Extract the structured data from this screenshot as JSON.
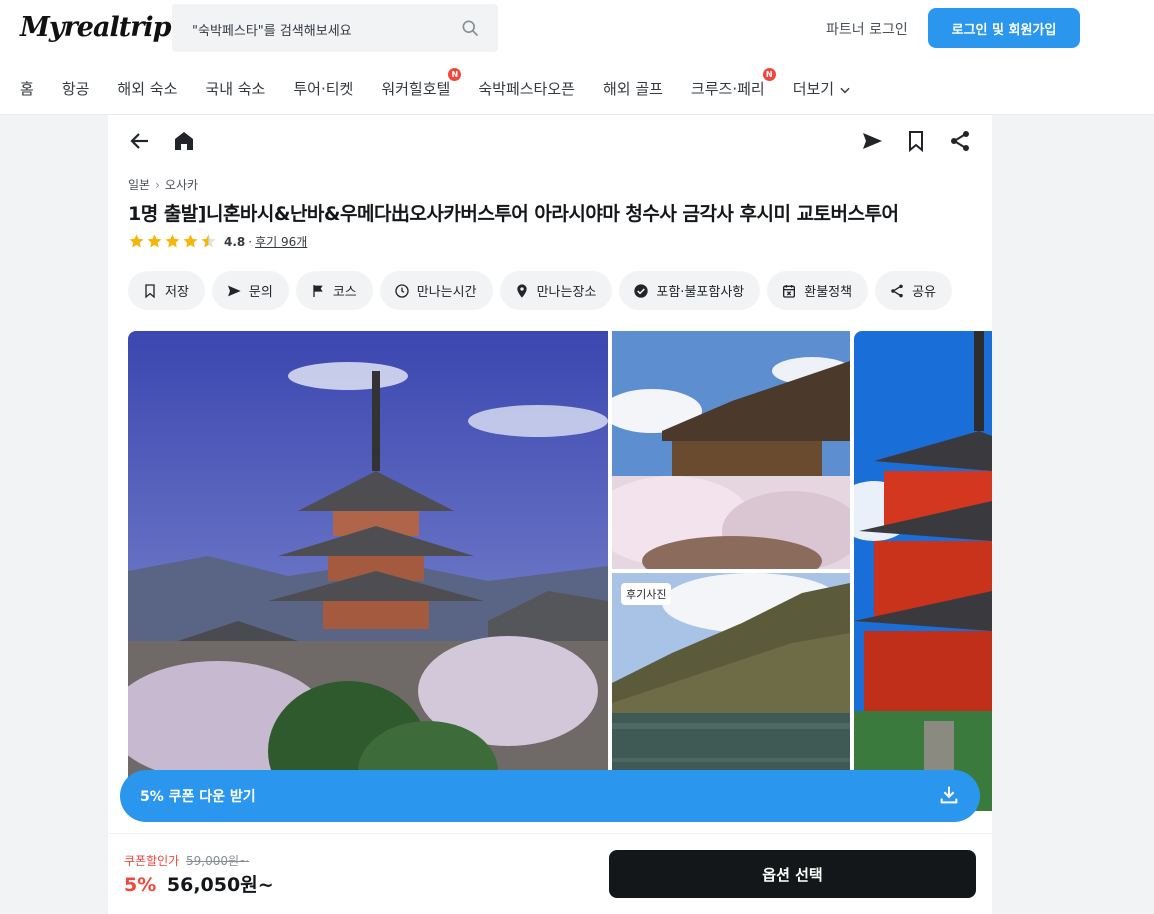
{
  "header": {
    "logo": "Myrealtrip",
    "search_placeholder": "\"숙박페스타\"를 검색해보세요",
    "partner_login": "파트너 로그인",
    "login_signup": "로그인 및 회원가입"
  },
  "nav": {
    "items": [
      {
        "label": "홈"
      },
      {
        "label": "항공"
      },
      {
        "label": "해외 숙소"
      },
      {
        "label": "국내 숙소"
      },
      {
        "label": "투어·티켓"
      },
      {
        "label": "워커힐호텔",
        "badge": "N"
      },
      {
        "label": "숙박페스타오픈"
      },
      {
        "label": "해외 골프"
      },
      {
        "label": "크루즈·페리",
        "badge": "N"
      },
      {
        "label": "더보기"
      }
    ]
  },
  "product": {
    "breadcrumb": [
      "일본",
      "오사카"
    ],
    "title": "1명 출발]니혼바시&난바&우메다出오사카버스투어 아라시야마 청수사 금각사 후시미 교토버스투어",
    "rating": "4.8",
    "rating_value": 4.5,
    "reviews": "후기 96개",
    "chips": [
      {
        "label": "저장",
        "icon": "bookmark-icon"
      },
      {
        "label": "문의",
        "icon": "send-icon"
      },
      {
        "label": "코스",
        "icon": "flag-icon"
      },
      {
        "label": "만나는시간",
        "icon": "clock-icon"
      },
      {
        "label": "만나는장소",
        "icon": "location-pin-icon"
      },
      {
        "label": "포함·불포함사항",
        "icon": "check-circle-icon"
      },
      {
        "label": "환불정책",
        "icon": "calendar-icon"
      },
      {
        "label": "공유",
        "icon": "share-icon"
      }
    ]
  },
  "gallery": {
    "review_tag": "후기사진"
  },
  "coupon": {
    "label": "5% 쿠폰 다운 받기"
  },
  "price": {
    "coupon_label": "쿠폰할인가",
    "original": "59,000원~",
    "discount": "5%",
    "final": "56,050원~",
    "option_button": "옵션 선택"
  },
  "colors": {
    "brand_blue": "#2b96ed",
    "discount_red": "#f0473c",
    "star_gold": "#f5b60b"
  }
}
